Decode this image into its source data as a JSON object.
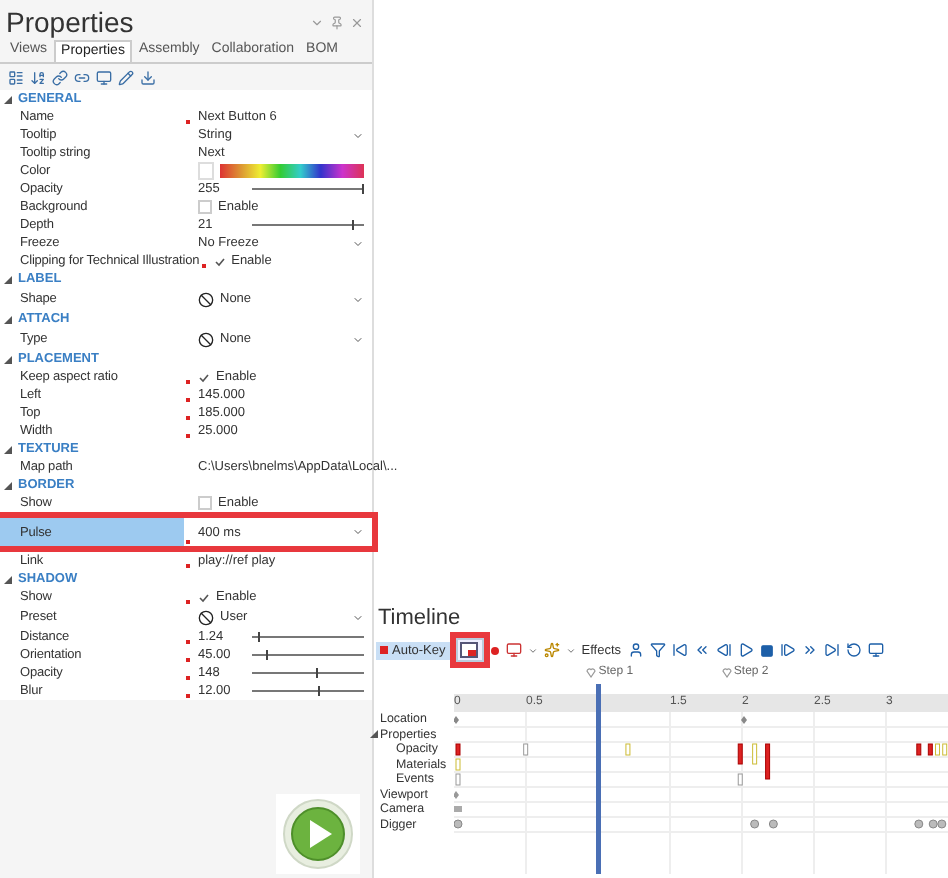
{
  "properties_panel": {
    "title": "Properties",
    "tabs": [
      {
        "label": "Views",
        "selected": false
      },
      {
        "label": "Properties",
        "selected": true
      },
      {
        "label": "Assembly",
        "selected": false
      },
      {
        "label": "Collaboration",
        "selected": false
      },
      {
        "label": "BOM",
        "selected": false
      }
    ],
    "sections": [
      {
        "title": "GENERAL",
        "expanded": true,
        "rows": [
          {
            "kind": "text",
            "label": "Name",
            "value": "Next Button 6",
            "modified": true,
            "selected": false,
            "highlighted": false
          },
          {
            "kind": "dropdown",
            "label": "Tooltip",
            "value": "String",
            "modified": false,
            "selected": false,
            "highlighted": false
          },
          {
            "kind": "text",
            "label": "Tooltip string",
            "value": "Next",
            "modified": false,
            "selected": false,
            "highlighted": false
          },
          {
            "kind": "color",
            "label": "Color",
            "modified": false,
            "selected": false,
            "highlighted": false
          },
          {
            "kind": "slider",
            "label": "Opacity",
            "value": "255",
            "level": 1.0,
            "modified": false,
            "selected": false,
            "highlighted": false
          },
          {
            "kind": "checkbox",
            "label": "Background",
            "value": "Enable",
            "checked": false,
            "modified": false,
            "selected": false,
            "highlighted": false
          },
          {
            "kind": "slider",
            "label": "Depth",
            "value": "21",
            "level": 0.9,
            "modified": false,
            "selected": false,
            "highlighted": false
          },
          {
            "kind": "dropdown",
            "label": "Freeze",
            "value": "No Freeze",
            "modified": false,
            "selected": false,
            "highlighted": false
          },
          {
            "kind": "checkbox",
            "label": "Clipping for Technical Illustration",
            "value": "Enable",
            "checked": true,
            "modified": true,
            "selected": false,
            "highlighted": false
          }
        ]
      },
      {
        "title": "LABEL",
        "expanded": true,
        "rows": [
          {
            "kind": "icon-dropdown",
            "label": "Shape",
            "value": "None",
            "modified": false,
            "selected": false,
            "highlighted": false
          }
        ]
      },
      {
        "title": "ATTACH",
        "expanded": true,
        "rows": [
          {
            "kind": "icon-dropdown",
            "label": "Type",
            "value": "None",
            "modified": false,
            "selected": false,
            "highlighted": false
          }
        ]
      },
      {
        "title": "PLACEMENT",
        "expanded": true,
        "rows": [
          {
            "kind": "checkbox",
            "label": "Keep aspect ratio",
            "value": "Enable",
            "checked": true,
            "modified": true,
            "selected": false,
            "highlighted": false
          },
          {
            "kind": "text",
            "label": "Left",
            "value": "145.000",
            "modified": true,
            "selected": false,
            "highlighted": false
          },
          {
            "kind": "text",
            "label": "Top",
            "value": "185.000",
            "modified": true,
            "selected": false,
            "highlighted": false
          },
          {
            "kind": "text",
            "label": "Width",
            "value": "25.000",
            "modified": true,
            "selected": false,
            "highlighted": false
          }
        ]
      },
      {
        "title": "TEXTURE",
        "expanded": true,
        "rows": [
          {
            "kind": "text",
            "label": "Map path",
            "value": "C:\\Users\\bnelms\\AppData\\Local\\...",
            "modified": false,
            "selected": false,
            "highlighted": false
          }
        ]
      },
      {
        "title": "BORDER",
        "expanded": true,
        "rows": [
          {
            "kind": "checkbox",
            "label": "Show",
            "value": "Enable",
            "checked": false,
            "modified": false,
            "selected": false,
            "highlighted": false
          },
          {
            "kind": "dropdown",
            "label": "Pulse",
            "value": "400 ms",
            "modified": true,
            "selected": true,
            "highlighted": true
          },
          {
            "kind": "text",
            "label": "Link",
            "value": "play://ref play",
            "modified": true,
            "selected": false,
            "highlighted": false
          }
        ]
      },
      {
        "title": "SHADOW",
        "expanded": true,
        "rows": [
          {
            "kind": "checkbox",
            "label": "Show",
            "value": "Enable",
            "checked": true,
            "modified": true,
            "selected": false,
            "highlighted": false
          },
          {
            "kind": "icon-dropdown",
            "label": "Preset",
            "value": "User",
            "modified": false,
            "selected": false,
            "highlighted": false
          },
          {
            "kind": "slider",
            "label": "Distance",
            "value": "1.24",
            "level": 0.05,
            "modified": true,
            "selected": false,
            "highlighted": false
          },
          {
            "kind": "slider",
            "label": "Orientation",
            "value": "45.00",
            "level": 0.13,
            "modified": true,
            "selected": false,
            "highlighted": false
          },
          {
            "kind": "slider",
            "label": "Opacity",
            "value": "148",
            "level": 0.58,
            "modified": true,
            "selected": false,
            "highlighted": false
          },
          {
            "kind": "slider",
            "label": "Blur",
            "value": "12.00",
            "level": 0.6,
            "modified": true,
            "selected": false,
            "highlighted": false
          }
        ]
      }
    ]
  },
  "timeline": {
    "title": "Timeline",
    "auto_key": {
      "label": "Auto-Key",
      "on": true
    },
    "tool_highlighted": true,
    "effects_label": "Effects",
    "steps": [
      "Step 1",
      "Step 2"
    ],
    "ruler": [
      "0",
      "0.5",
      "1.5",
      "2",
      "2.5",
      "3"
    ],
    "tracks": [
      {
        "label": "Location"
      },
      {
        "label": "Properties",
        "expanded": true,
        "children": [
          {
            "label": "Opacity"
          },
          {
            "label": "Materials"
          },
          {
            "label": "Events"
          }
        ]
      },
      {
        "label": "Viewport"
      },
      {
        "label": "Camera"
      },
      {
        "label": "Digger"
      }
    ]
  }
}
